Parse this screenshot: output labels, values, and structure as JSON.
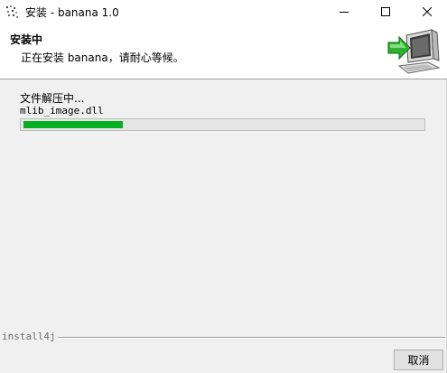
{
  "window": {
    "title": "安装 - banana 1.0"
  },
  "header": {
    "title": "安装中",
    "subtitle": "正在安装 banana，请耐心等候。",
    "graphic": "install-computer-arrow-icon"
  },
  "content": {
    "status": "文件解压中...",
    "current_file": "mlib_image.dll",
    "progress": 0.25
  },
  "footer": {
    "brand": "install4j",
    "cancel_label": "取消"
  },
  "colors": {
    "progress_fill": "#06b025",
    "background": "#f0f0f0"
  }
}
